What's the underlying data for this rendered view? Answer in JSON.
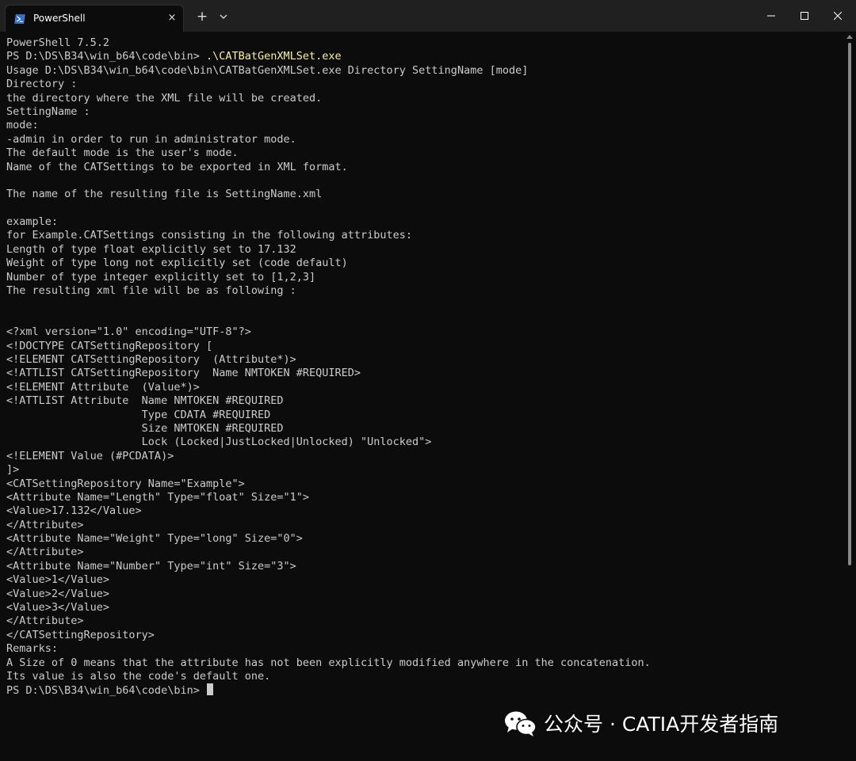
{
  "window": {
    "tab_title": "PowerShell",
    "tab_close_icon": "×",
    "new_tab_icon": "+"
  },
  "colors": {
    "terminal_bg": "#0c0c0c",
    "text": "#cccccc",
    "command": "#f9f1a5"
  },
  "terminal": {
    "prompt_path": "PS D:\\DS\\B34\\win_b64\\code\\bin> ",
    "command": ".\\CATBatGenXMLSet.exe",
    "lines_a": [
      "PowerShell 7.5.2"
    ],
    "lines_b": [
      "Usage D:\\DS\\B34\\win_b64\\code\\bin\\CATBatGenXMLSet.exe Directory SettingName [mode]",
      "Directory :",
      "the directory where the XML file will be created.",
      "SettingName :",
      "mode:",
      "-admin in order to run in administrator mode.",
      "The default mode is the user's mode.",
      "Name of the CATSettings to be exported in XML format.",
      "",
      "The name of the resulting file is SettingName.xml",
      "",
      "example:",
      "for Example.CATSettings consisting in the following attributes:",
      "Length of type float explicitly set to 17.132",
      "Weight of type long not explicitly set (code default)",
      "Number of type integer explicitly set to [1,2,3]",
      "The resulting xml file will be as following :",
      "",
      "",
      "<?xml version=\"1.0\" encoding=\"UTF-8\"?>",
      "<!DOCTYPE CATSettingRepository [",
      "<!ELEMENT CATSettingRepository  (Attribute*)>",
      "<!ATTLIST CATSettingRepository  Name NMTOKEN #REQUIRED>",
      "<!ELEMENT Attribute  (Value*)>",
      "<!ATTLIST Attribute  Name NMTOKEN #REQUIRED",
      "                     Type CDATA #REQUIRED",
      "                     Size NMTOKEN #REQUIRED",
      "                     Lock (Locked|JustLocked|Unlocked) \"Unlocked\">",
      "<!ELEMENT Value (#PCDATA)>",
      "]>",
      "<CATSettingRepository Name=\"Example\">",
      "<Attribute Name=\"Length\" Type=\"float\" Size=\"1\">",
      "<Value>17.132</Value>",
      "</Attribute>",
      "<Attribute Name=\"Weight\" Type=\"long\" Size=\"0\">",
      "</Attribute>",
      "<Attribute Name=\"Number\" Type=\"int\" Size=\"3\">",
      "<Value>1</Value>",
      "<Value>2</Value>",
      "<Value>3</Value>",
      "</Attribute>",
      "</CATSettingRepository>",
      "Remarks:",
      "A Size of 0 means that the attribute has not been explicitly modified anywhere in the concatenation.",
      "Its value is also the code's default one."
    ],
    "final_prompt": "PS D:\\DS\\B34\\win_b64\\code\\bin> "
  },
  "watermark": {
    "text": "公众号 · CATIA开发者指南",
    "logo_icon": "wechat-icon"
  }
}
